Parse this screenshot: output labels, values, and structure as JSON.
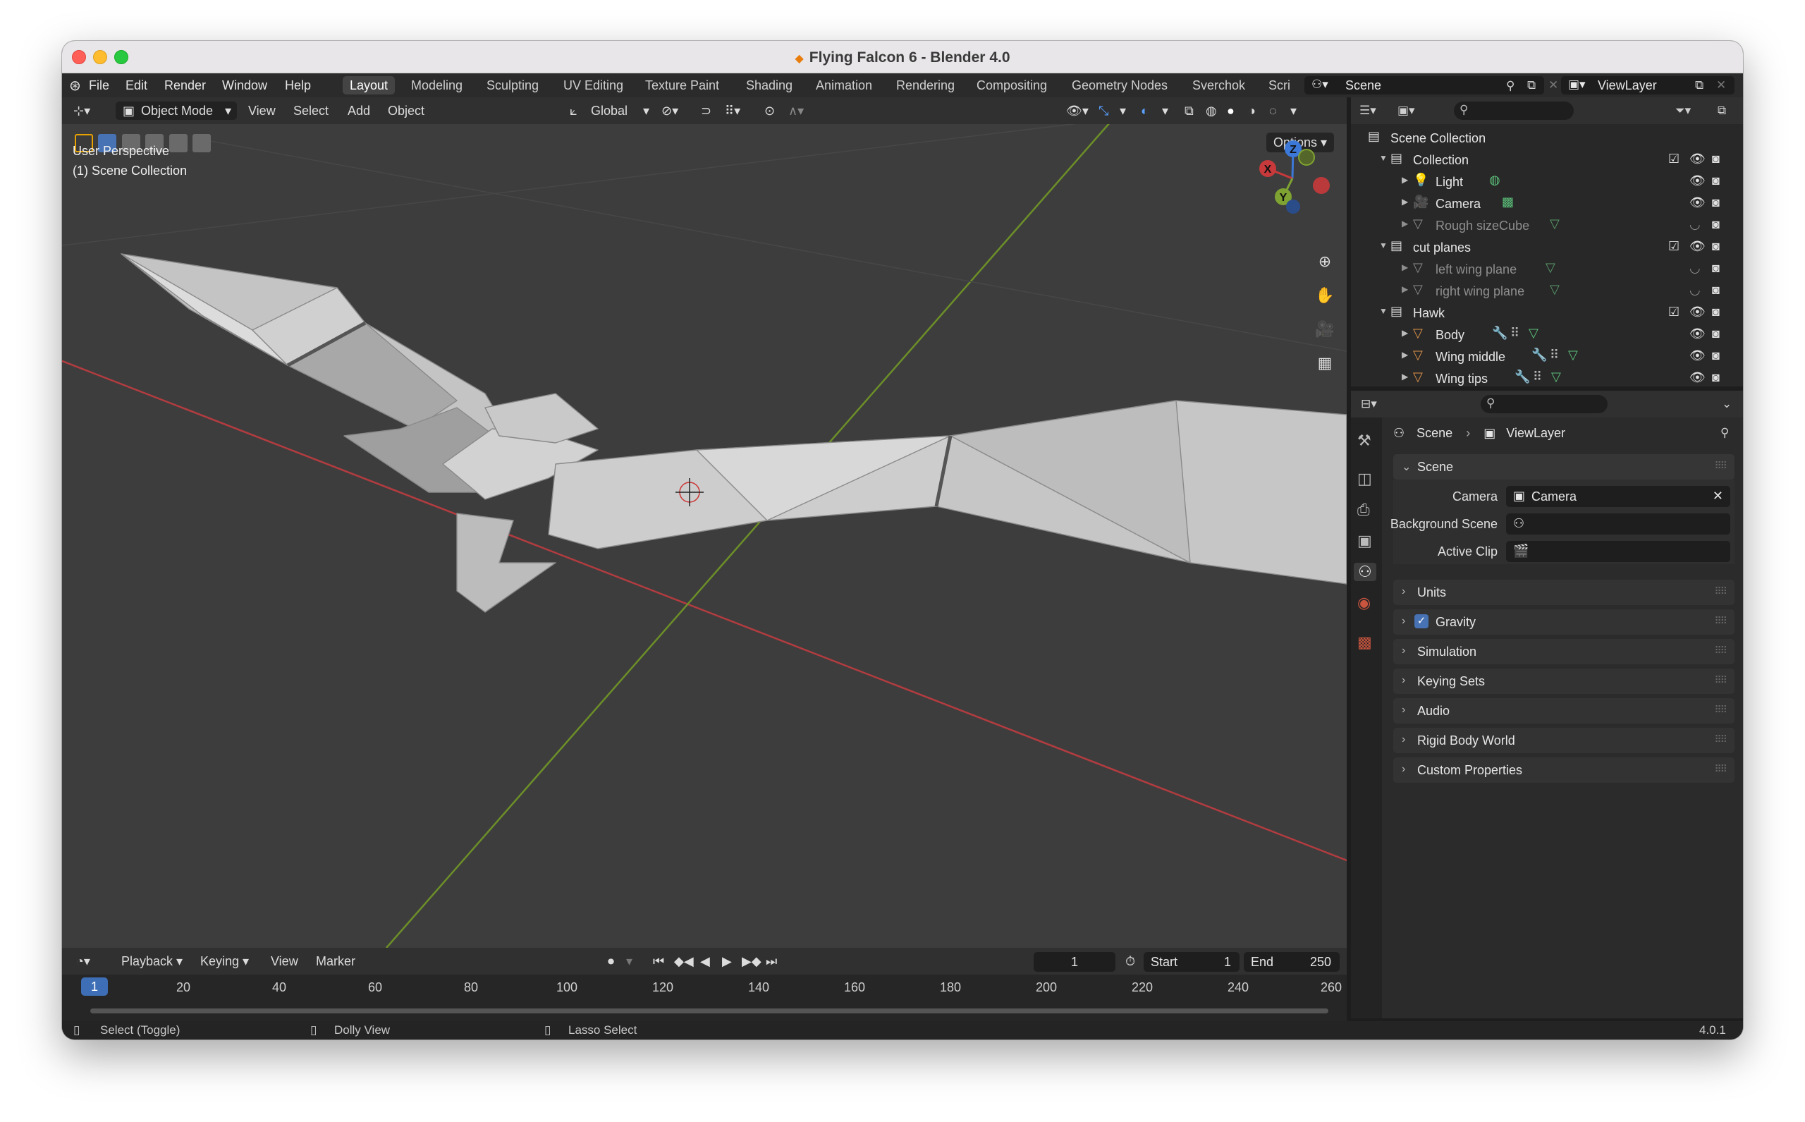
{
  "window": {
    "title": "Flying Falcon 6 - Blender 4.0"
  },
  "menu": [
    "File",
    "Edit",
    "Render",
    "Window",
    "Help"
  ],
  "workspaces": [
    "Layout",
    "Modeling",
    "Sculpting",
    "UV Editing",
    "Texture Paint",
    "Shading",
    "Animation",
    "Rendering",
    "Compositing",
    "Geometry Nodes",
    "Sverchok",
    "Scri"
  ],
  "scene_field": "Scene",
  "viewlayer_field": "ViewLayer",
  "viewport": {
    "mode": "Object Mode",
    "menus": [
      "View",
      "Select",
      "Add",
      "Object"
    ],
    "transform_orientation": "Global",
    "options_label": "Options",
    "overlay_line1": "User Perspective",
    "overlay_line2": "(1) Scene Collection",
    "gizmo": {
      "x": "X",
      "y": "Y",
      "z": "Z"
    }
  },
  "timeline": {
    "menus": [
      "Playback",
      "Keying",
      "View",
      "Marker"
    ],
    "current_frame": "1",
    "start_label": "Start",
    "start_value": "1",
    "end_label": "End",
    "end_value": "250",
    "ruler": [
      "20",
      "40",
      "60",
      "80",
      "100",
      "120",
      "140",
      "160",
      "180",
      "200",
      "220",
      "240",
      "260"
    ],
    "badge": "1"
  },
  "status": {
    "left": "Select (Toggle)",
    "middle": "Dolly View",
    "right": "Lasso Select",
    "version": "4.0.1"
  },
  "outliner": {
    "root": "Scene Collection",
    "rows": [
      {
        "label": "Collection"
      },
      {
        "label": "Light"
      },
      {
        "label": "Camera"
      },
      {
        "label": "Rough sizeCube"
      },
      {
        "label": "cut planes"
      },
      {
        "label": "left wing plane"
      },
      {
        "label": "right wing plane"
      },
      {
        "label": "Hawk"
      },
      {
        "label": "Body"
      },
      {
        "label": "Wing middle"
      },
      {
        "label": "Wing tips"
      }
    ]
  },
  "properties": {
    "breadcrumb_scene": "Scene",
    "breadcrumb_viewlayer": "ViewLayer",
    "scene_panel": "Scene",
    "camera_label": "Camera",
    "camera_value": "Camera",
    "background_scene_label": "Background Scene",
    "active_clip_label": "Active Clip",
    "panels": [
      "Units",
      "Gravity",
      "Simulation",
      "Keying Sets",
      "Audio",
      "Rigid Body World",
      "Custom Properties"
    ]
  },
  "colors": {
    "accent": "#3e6fb6",
    "axis_x": "#c8393b",
    "axis_y": "#7fa332",
    "axis_z": "#3c78d8"
  }
}
